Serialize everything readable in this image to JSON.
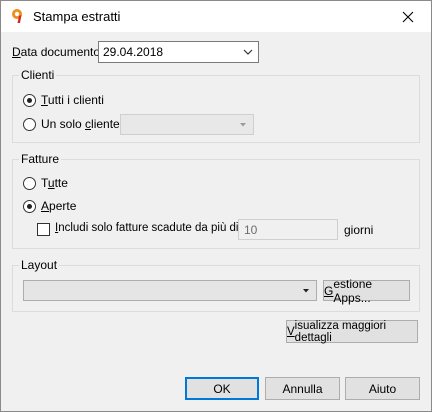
{
  "window": {
    "title": "Stampa estratti"
  },
  "document_date": {
    "label_underlined": "D",
    "label_rest": "ata documento",
    "value": "29.04.2018"
  },
  "clienti": {
    "group_title": "Clienti",
    "all": {
      "u": "T",
      "rest": "utti i clienti",
      "selected": true
    },
    "single": {
      "pre": "Un solo ",
      "u": "c",
      "rest": "liente",
      "selected": false
    }
  },
  "fatture": {
    "group_title": "Fatture",
    "all": {
      "pre": "T",
      "u": "u",
      "rest": "tte",
      "selected": false
    },
    "open": {
      "u": "A",
      "rest": "perte",
      "selected": true
    },
    "overdue": {
      "pre": "",
      "u": "I",
      "rest": "ncludi solo fatture scadute da più di",
      "checked": false,
      "days_value": "10",
      "days_unit": "giorni"
    }
  },
  "layout": {
    "group_title": "Layout",
    "manage_button": {
      "pre": "",
      "u": "G",
      "rest": "estione Apps..."
    }
  },
  "details_button": {
    "u": "V",
    "rest": "isualizza maggiori dettagli"
  },
  "footer": {
    "ok": "OK",
    "cancel": "Annulla",
    "help": "Aiuto"
  },
  "colors": {
    "accent": "#0078d7",
    "app_icon_orange": "#f28c1a",
    "app_icon_red": "#d6281e"
  }
}
